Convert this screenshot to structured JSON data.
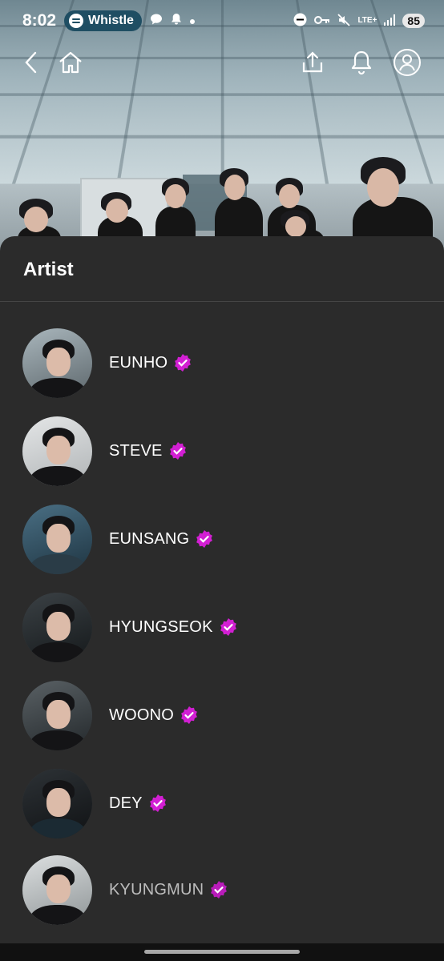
{
  "status_bar": {
    "time": "8:02",
    "media_app": "Whistle",
    "battery": "85",
    "network": "LTE+"
  },
  "top_nav": {
    "back_icon": "chevron-left-icon",
    "home_icon": "home-icon",
    "share_icon": "share-icon",
    "notifications_icon": "bell-icon",
    "profile_icon": "profile-icon"
  },
  "sheet": {
    "title": "Artist",
    "artists": [
      {
        "name": "EUNHO",
        "verified": true
      },
      {
        "name": "STEVE",
        "verified": true
      },
      {
        "name": "EUNSANG",
        "verified": true
      },
      {
        "name": "HYUNGSEOK",
        "verified": true
      },
      {
        "name": "WOONO",
        "verified": true
      },
      {
        "name": "DEY",
        "verified": true
      },
      {
        "name": "KYUNGMUN",
        "verified": true
      }
    ]
  },
  "colors": {
    "sheet_bg": "#2b2b2b",
    "verified_badge": "#d21fd3",
    "divider": "#454545",
    "media_pill": "#1f4e63"
  }
}
